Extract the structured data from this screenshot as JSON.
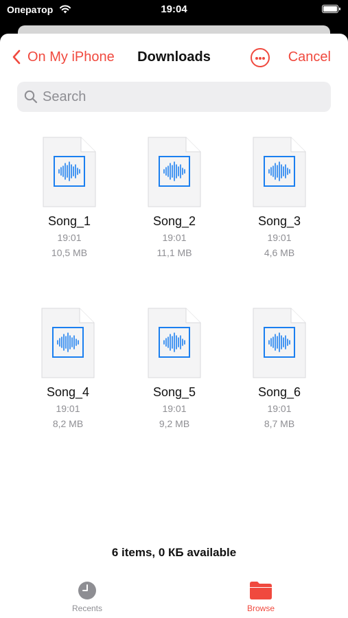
{
  "status_bar": {
    "carrier": "Оператор",
    "time": "19:04"
  },
  "nav": {
    "back_label": "On My iPhone",
    "title": "Downloads",
    "cancel_label": "Cancel"
  },
  "search": {
    "placeholder": "Search"
  },
  "files": [
    {
      "name": "Song_1",
      "time": "19:01",
      "size": "10,5 MB"
    },
    {
      "name": "Song_2",
      "time": "19:01",
      "size": "11,1 MB"
    },
    {
      "name": "Song_3",
      "time": "19:01",
      "size": "4,6 MB"
    },
    {
      "name": "Song_4",
      "time": "19:01",
      "size": "8,2 MB"
    },
    {
      "name": "Song_5",
      "time": "19:01",
      "size": "9,2 MB"
    },
    {
      "name": "Song_6",
      "time": "19:01",
      "size": "8,7 MB"
    }
  ],
  "footer": {
    "status": "6 items, 0 КБ available"
  },
  "tabs": [
    {
      "label": "Recents",
      "icon": "clock-icon"
    },
    {
      "label": "Browse",
      "icon": "folder-icon"
    }
  ],
  "colors": {
    "accent": "#f0493e",
    "audio_icon": "#1a7ff0"
  }
}
